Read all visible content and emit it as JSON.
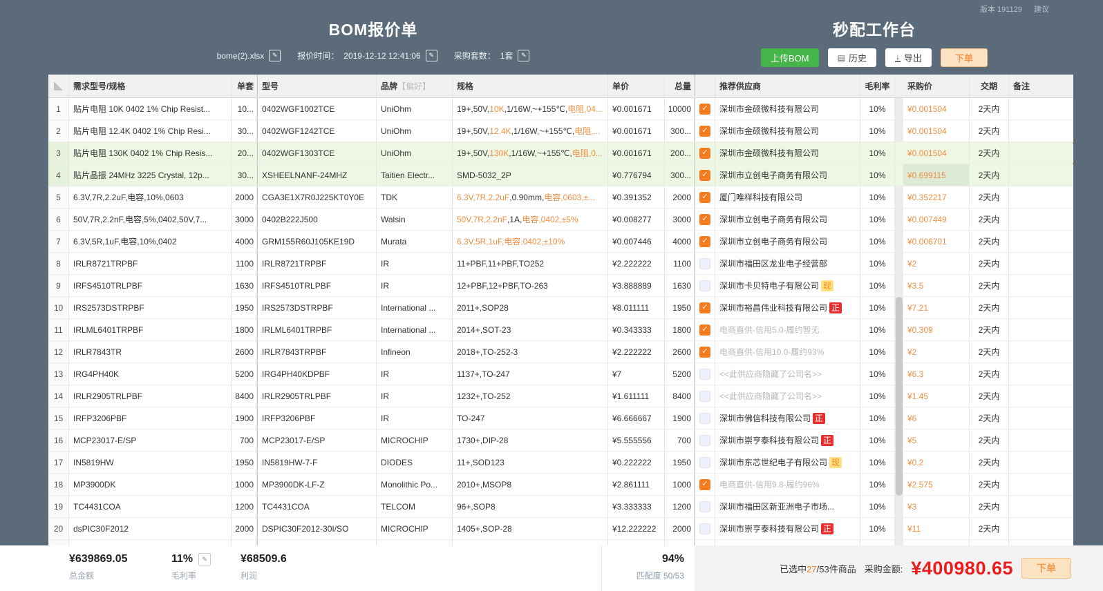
{
  "colors": {
    "page_background": "#5c6b7a",
    "accent_orange": "#f57b20",
    "highlight_text_orange": "#ef8f43",
    "selected_row_border": "#efa055",
    "matched_row_green": "#eef7e4",
    "badge_red": "#e62e2e",
    "badge_yellow_bg": "#ffe083",
    "badge_yellow_text": "#f5881e",
    "upload_button_green": "#45b549",
    "order_button_bg": "#fbe3c4",
    "order_button_text": "#f2994a",
    "purchase_total_red": "#ed1c1c"
  },
  "header": {
    "version": "版本 191129",
    "suggestion": "建议",
    "bom_title": "BOM报价单",
    "workbench_title": "秒配工作台",
    "file_name": "bome(2).xlsx",
    "quote_time_label": "报价时间：",
    "quote_time": "2019-12-12 12:41:06",
    "sets_label": "采购套数：",
    "sets_value": "1套",
    "upload_button": "上传BOM",
    "history_button": "历史",
    "export_button": "导出",
    "order_button": "下单"
  },
  "table": {
    "headers": {
      "demand": "需求型号/规格",
      "per_set": "单套",
      "model": "型号",
      "brand": "品牌",
      "brand_pref": "【偏好】",
      "spec": "规格",
      "unit_price": "单价",
      "total_qty": "总量",
      "supplier": "推荐供应商",
      "margin": "毛利率",
      "purchase_price": "采购价",
      "delivery": "交期",
      "remark": "备注"
    },
    "rows": [
      {
        "no": "1",
        "demand": "贴片电阻 10K 0402 1% Chip Resist...",
        "per_set": "10...",
        "model": "0402WGF1002TCE",
        "brand": "UniOhm",
        "spec": [
          [
            "19+,50V,",
            0
          ],
          [
            "10K",
            1
          ],
          [
            ",1/16W,~+155℃,",
            0
          ],
          [
            "电阻,04...",
            1
          ]
        ],
        "unit_price": "¥0.001671",
        "total_qty": "10000",
        "checked": true,
        "supplier": "深圳市金硕微科技有限公司",
        "badge": "",
        "supplier_gray": false,
        "margin": "10%",
        "purchase_price": "¥0.001504",
        "delivery": "2天内",
        "remark": "",
        "green": false,
        "sel": false,
        "tint": false
      },
      {
        "no": "2",
        "demand": "贴片电阻 12.4K 0402 1% Chip Resi...",
        "per_set": "30...",
        "model": "0402WGF1242TCE",
        "brand": "UniOhm",
        "spec": [
          [
            "19+,50V,",
            0
          ],
          [
            "12.4K",
            1
          ],
          [
            ",1/16W,~+155℃,",
            0
          ],
          [
            "电阻,...",
            1
          ]
        ],
        "unit_price": "¥0.001671",
        "total_qty": "300...",
        "checked": true,
        "supplier": "深圳市金硕微科技有限公司",
        "badge": "",
        "supplier_gray": false,
        "margin": "10%",
        "purchase_price": "¥0.001504",
        "delivery": "2天内",
        "remark": "",
        "green": false,
        "sel": false,
        "tint": false
      },
      {
        "no": "3",
        "demand": "贴片电阻 130K 0402 1% Chip Resis...",
        "per_set": "20...",
        "model": "0402WGF1303TCE",
        "brand": "UniOhm",
        "spec": [
          [
            "19+,50V,",
            0
          ],
          [
            "130K",
            1
          ],
          [
            ",1/16W,~+155℃,",
            0
          ],
          [
            "电阻,0...",
            1
          ]
        ],
        "unit_price": "¥0.001671",
        "total_qty": "200...",
        "checked": true,
        "supplier": "深圳市金硕微科技有限公司",
        "badge": "",
        "supplier_gray": false,
        "margin": "10%",
        "purchase_price": "¥0.001504",
        "delivery": "2天内",
        "remark": "",
        "green": true,
        "sel": true,
        "tint": false
      },
      {
        "no": "4",
        "demand": "贴片晶振 24MHz 3225 Crystal, 12p...",
        "per_set": "30...",
        "model": "XSHEELNANF-24MHZ",
        "brand": "Taitien Electr...",
        "spec": [
          [
            "SMD-5032_2P",
            0
          ]
        ],
        "unit_price": "¥0.776794",
        "total_qty": "300...",
        "checked": true,
        "supplier": "深圳市立创电子商务有限公司",
        "badge": "",
        "supplier_gray": false,
        "margin": "10%",
        "purchase_price": "¥0.699115",
        "delivery": "2天内",
        "remark": "",
        "green": true,
        "sel": false,
        "tint": true
      },
      {
        "no": "5",
        "demand": "6.3V,7R,2.2uF,电容,10%,0603",
        "per_set": "2000",
        "model": "CGA3E1X7R0J225KT0Y0E",
        "brand": "TDK",
        "spec": [
          [
            "6.3V,7R,2.2uF",
            1
          ],
          [
            ",0.90mm,",
            0
          ],
          [
            "电容,0603,±...",
            1
          ]
        ],
        "unit_price": "¥0.391352",
        "total_qty": "2000",
        "checked": true,
        "supplier": "厦门唯样科技有限公司",
        "badge": "",
        "supplier_gray": false,
        "margin": "10%",
        "purchase_price": "¥0.352217",
        "delivery": "2天内",
        "remark": "",
        "green": false,
        "sel": false,
        "tint": false
      },
      {
        "no": "6",
        "demand": "50V,7R,2.2nF,电容,5%,0402,50V,7...",
        "per_set": "3000",
        "model": "0402B222J500",
        "brand": "Walsin",
        "spec": [
          [
            "50V,7R,2.2nF",
            1
          ],
          [
            ",1A,",
            0
          ],
          [
            "电容,0402,±5%",
            1
          ]
        ],
        "unit_price": "¥0.008277",
        "total_qty": "3000",
        "checked": true,
        "supplier": "深圳市立创电子商务有限公司",
        "badge": "",
        "supplier_gray": false,
        "margin": "10%",
        "purchase_price": "¥0.007449",
        "delivery": "2天内",
        "remark": "",
        "green": false,
        "sel": false,
        "tint": false
      },
      {
        "no": "7",
        "demand": "6.3V,5R,1uF,电容,10%,0402",
        "per_set": "4000",
        "model": "GRM155R60J105KE19D",
        "brand": "Murata",
        "spec": [
          [
            "6.3V,5R,1uF,电容,0402,±10%",
            1
          ]
        ],
        "unit_price": "¥0.007446",
        "total_qty": "4000",
        "checked": true,
        "supplier": "深圳市立创电子商务有限公司",
        "badge": "",
        "supplier_gray": false,
        "margin": "10%",
        "purchase_price": "¥0.006701",
        "delivery": "2天内",
        "remark": "",
        "green": false,
        "sel": false,
        "tint": false
      },
      {
        "no": "8",
        "demand": "IRLR8721TRPBF",
        "per_set": "1100",
        "model": "IRLR8721TRPBF",
        "brand": "IR",
        "spec": [
          [
            "11+PBF,11+PBF,TO252",
            0
          ]
        ],
        "unit_price": "¥2.222222",
        "total_qty": "1100",
        "checked": false,
        "supplier": "深圳市福田区龙业电子经营部",
        "badge": "",
        "supplier_gray": false,
        "margin": "10%",
        "purchase_price": "¥2",
        "delivery": "2天内",
        "remark": "",
        "green": false,
        "sel": false,
        "tint": false
      },
      {
        "no": "9",
        "demand": "IRFS4510TRLPBF",
        "per_set": "1630",
        "model": "IRFS4510TRLPBF",
        "brand": "IR",
        "spec": [
          [
            "12+PBF,12+PBF,TO-263",
            0
          ]
        ],
        "unit_price": "¥3.888889",
        "total_qty": "1630",
        "checked": false,
        "supplier": "深圳市卡贝特电子有限公司",
        "badge": "现",
        "supplier_gray": false,
        "margin": "10%",
        "purchase_price": "¥3.5",
        "delivery": "2天内",
        "remark": "",
        "green": false,
        "sel": false,
        "tint": false
      },
      {
        "no": "10",
        "demand": "IRS2573DSTRPBF",
        "per_set": "1950",
        "model": "IRS2573DSTRPBF",
        "brand": "International ...",
        "spec": [
          [
            "2011+,SOP28",
            0
          ]
        ],
        "unit_price": "¥8.011111",
        "total_qty": "1950",
        "checked": true,
        "supplier": "深圳市裕昌伟业科技有限公司",
        "badge": "正",
        "supplier_gray": false,
        "margin": "10%",
        "purchase_price": "¥7.21",
        "delivery": "2天内",
        "remark": "",
        "green": false,
        "sel": false,
        "tint": false
      },
      {
        "no": "11",
        "demand": "IRLML6401TRPBF",
        "per_set": "1800",
        "model": "IRLML6401TRPBF",
        "brand": "International ...",
        "spec": [
          [
            "2014+,SOT-23",
            0
          ]
        ],
        "unit_price": "¥0.343333",
        "total_qty": "1800",
        "checked": true,
        "supplier": "电商直供-信用5.0-履约暂无",
        "badge": "",
        "supplier_gray": true,
        "margin": "10%",
        "purchase_price": "¥0.309",
        "delivery": "2天内",
        "remark": "",
        "green": false,
        "sel": false,
        "tint": false
      },
      {
        "no": "12",
        "demand": "IRLR7843TR",
        "per_set": "2600",
        "model": "IRLR7843TRPBF",
        "brand": "Infineon",
        "spec": [
          [
            "2018+,TO-252-3",
            0
          ]
        ],
        "unit_price": "¥2.222222",
        "total_qty": "2600",
        "checked": true,
        "supplier": "电商直供-信用10.0-履约93%",
        "badge": "",
        "supplier_gray": true,
        "margin": "10%",
        "purchase_price": "¥2",
        "delivery": "2天内",
        "remark": "",
        "green": false,
        "sel": false,
        "tint": false
      },
      {
        "no": "13",
        "demand": "IRG4PH40K",
        "per_set": "5200",
        "model": "IRG4PH40KDPBF",
        "brand": "IR",
        "spec": [
          [
            "1137+,TO-247",
            0
          ]
        ],
        "unit_price": "¥7",
        "total_qty": "5200",
        "checked": false,
        "supplier": "<<此供应商隐藏了公司名>>",
        "badge": "",
        "supplier_gray": true,
        "margin": "10%",
        "purchase_price": "¥6.3",
        "delivery": "2天内",
        "remark": "",
        "green": false,
        "sel": false,
        "tint": false
      },
      {
        "no": "14",
        "demand": "IRLR2905TRLPBF",
        "per_set": "8400",
        "model": "IRLR2905TRLPBF",
        "brand": "IR",
        "spec": [
          [
            "1232+,TO-252",
            0
          ]
        ],
        "unit_price": "¥1.611111",
        "total_qty": "8400",
        "checked": false,
        "supplier": "<<此供应商隐藏了公司名>>",
        "badge": "",
        "supplier_gray": true,
        "margin": "10%",
        "purchase_price": "¥1.45",
        "delivery": "2天内",
        "remark": "",
        "green": false,
        "sel": false,
        "tint": false
      },
      {
        "no": "15",
        "demand": "IRFP3206PBF",
        "per_set": "1900",
        "model": "IRFP3206PBF",
        "brand": "IR",
        "spec": [
          [
            "TO-247",
            0
          ]
        ],
        "unit_price": "¥6.666667",
        "total_qty": "1900",
        "checked": false,
        "supplier": "深圳市佛信科技有限公司",
        "badge": "正",
        "supplier_gray": false,
        "margin": "10%",
        "purchase_price": "¥6",
        "delivery": "2天内",
        "remark": "",
        "green": false,
        "sel": false,
        "tint": false
      },
      {
        "no": "16",
        "demand": "MCP23017-E/SP",
        "per_set": "700",
        "model": "MCP23017-E/SP",
        "brand": "MICROCHIP",
        "spec": [
          [
            "1730+,DIP-28",
            0
          ]
        ],
        "unit_price": "¥5.555556",
        "total_qty": "700",
        "checked": false,
        "supplier": "深圳市崇亨泰科技有限公司",
        "badge": "正",
        "supplier_gray": false,
        "margin": "10%",
        "purchase_price": "¥5",
        "delivery": "2天内",
        "remark": "",
        "green": false,
        "sel": false,
        "tint": false
      },
      {
        "no": "17",
        "demand": "IN5819HW",
        "per_set": "1950",
        "model": "IN5819HW-7-F",
        "brand": "DIODES",
        "spec": [
          [
            "11+,SOD123",
            0
          ]
        ],
        "unit_price": "¥0.222222",
        "total_qty": "1950",
        "checked": false,
        "supplier": "深圳市东芯世纪电子有限公司",
        "badge": "现",
        "supplier_gray": false,
        "margin": "10%",
        "purchase_price": "¥0.2",
        "delivery": "2天内",
        "remark": "",
        "green": false,
        "sel": false,
        "tint": false
      },
      {
        "no": "18",
        "demand": "MP3900DK",
        "per_set": "1000",
        "model": "MP3900DK-LF-Z",
        "brand": "Monolithic Po...",
        "spec": [
          [
            "2010+,MSOP8",
            0
          ]
        ],
        "unit_price": "¥2.861111",
        "total_qty": "1000",
        "checked": true,
        "supplier": "电商直供-信用9.8-履约96%",
        "badge": "",
        "supplier_gray": true,
        "margin": "10%",
        "purchase_price": "¥2.575",
        "delivery": "2天内",
        "remark": "",
        "green": false,
        "sel": false,
        "tint": false
      },
      {
        "no": "19",
        "demand": "TC4431COA",
        "per_set": "1200",
        "model": "TC4431COA",
        "brand": "TELCOM",
        "spec": [
          [
            "96+,SOP8",
            0
          ]
        ],
        "unit_price": "¥3.333333",
        "total_qty": "1200",
        "checked": false,
        "supplier": "深圳市福田区新亚洲电子市场...",
        "badge": "",
        "supplier_gray": false,
        "margin": "10%",
        "purchase_price": "¥3",
        "delivery": "2天内",
        "remark": "",
        "green": false,
        "sel": false,
        "tint": false
      },
      {
        "no": "20",
        "demand": "dsPIC30F2012",
        "per_set": "2000",
        "model": "DSPIC30F2012-30I/SO",
        "brand": "MICROCHIP",
        "spec": [
          [
            "1405+,SOP-28",
            0
          ]
        ],
        "unit_price": "¥12.222222",
        "total_qty": "2000",
        "checked": false,
        "supplier": "深圳市崇亨泰科技有限公司",
        "badge": "正",
        "supplier_gray": false,
        "margin": "10%",
        "purchase_price": "¥11",
        "delivery": "2天内",
        "remark": "",
        "green": false,
        "sel": false,
        "tint": false
      }
    ]
  },
  "footer": {
    "total_amount": "¥639869.05",
    "total_label": "总金额",
    "margin": "11%",
    "margin_label": "毛利率",
    "profit": "¥68509.6",
    "profit_label": "利润",
    "match_pct": "94%",
    "match_label": "匹配度",
    "match_ratio": "50/53",
    "selected_prefix": "已选中",
    "selected_count": "27",
    "selected_suffix": "/53件商品",
    "purchase_label": "采购金额:",
    "purchase_total": "¥400980.65",
    "order_button": "下单"
  }
}
